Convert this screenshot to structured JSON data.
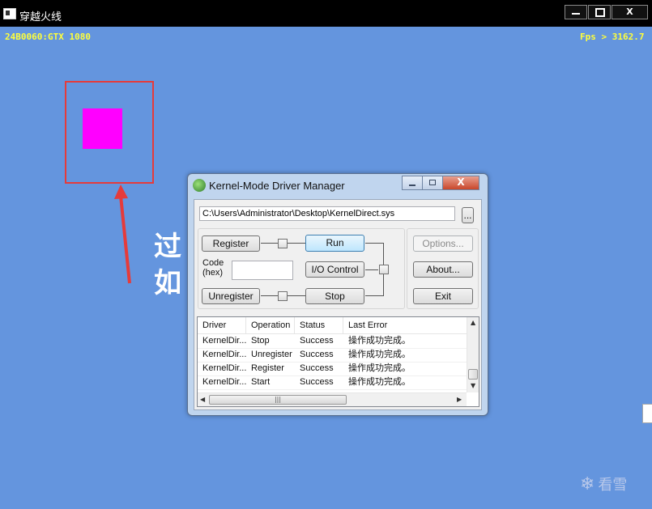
{
  "window": {
    "title": "穿越火线",
    "close_label": "X"
  },
  "hud": {
    "left_text": "24B0060:GTX 1080",
    "right_text": "Fps > 3162.7"
  },
  "overlay": {
    "banner_line1": "过",
    "banner_line2": "如",
    "banner_right1": "",
    "banner_right2": "",
    "watermark": "看雪",
    "colors": {
      "background": "#6495de",
      "box": "#e53b3b",
      "square": "#ff00ff",
      "hud": "#ffff3a"
    }
  },
  "dialog": {
    "title": "Kernel-Mode Driver Manager",
    "driver_path": "C:\\Users\\Administrator\\Desktop\\KernelDirect.sys",
    "browse_label": "...",
    "buttons": {
      "register": "Register",
      "run": "Run",
      "io_control": "I/O Control",
      "unregister": "Unregister",
      "stop": "Stop",
      "options": "Options...",
      "about": "About...",
      "exit": "Exit"
    },
    "code_label_1": "Code",
    "code_label_2": "(hex)",
    "code_value": "",
    "list": {
      "columns": [
        "Driver",
        "Operation",
        "Status",
        "Last Error"
      ],
      "rows": [
        [
          "KernelDir...",
          "Stop",
          "Success",
          "操作成功完成。"
        ],
        [
          "KernelDir...",
          "Unregister",
          "Success",
          "操作成功完成。"
        ],
        [
          "KernelDir...",
          "Register",
          "Success",
          "操作成功完成。"
        ],
        [
          "KernelDir...",
          "Start",
          "Success",
          "操作成功完成。"
        ]
      ]
    }
  }
}
